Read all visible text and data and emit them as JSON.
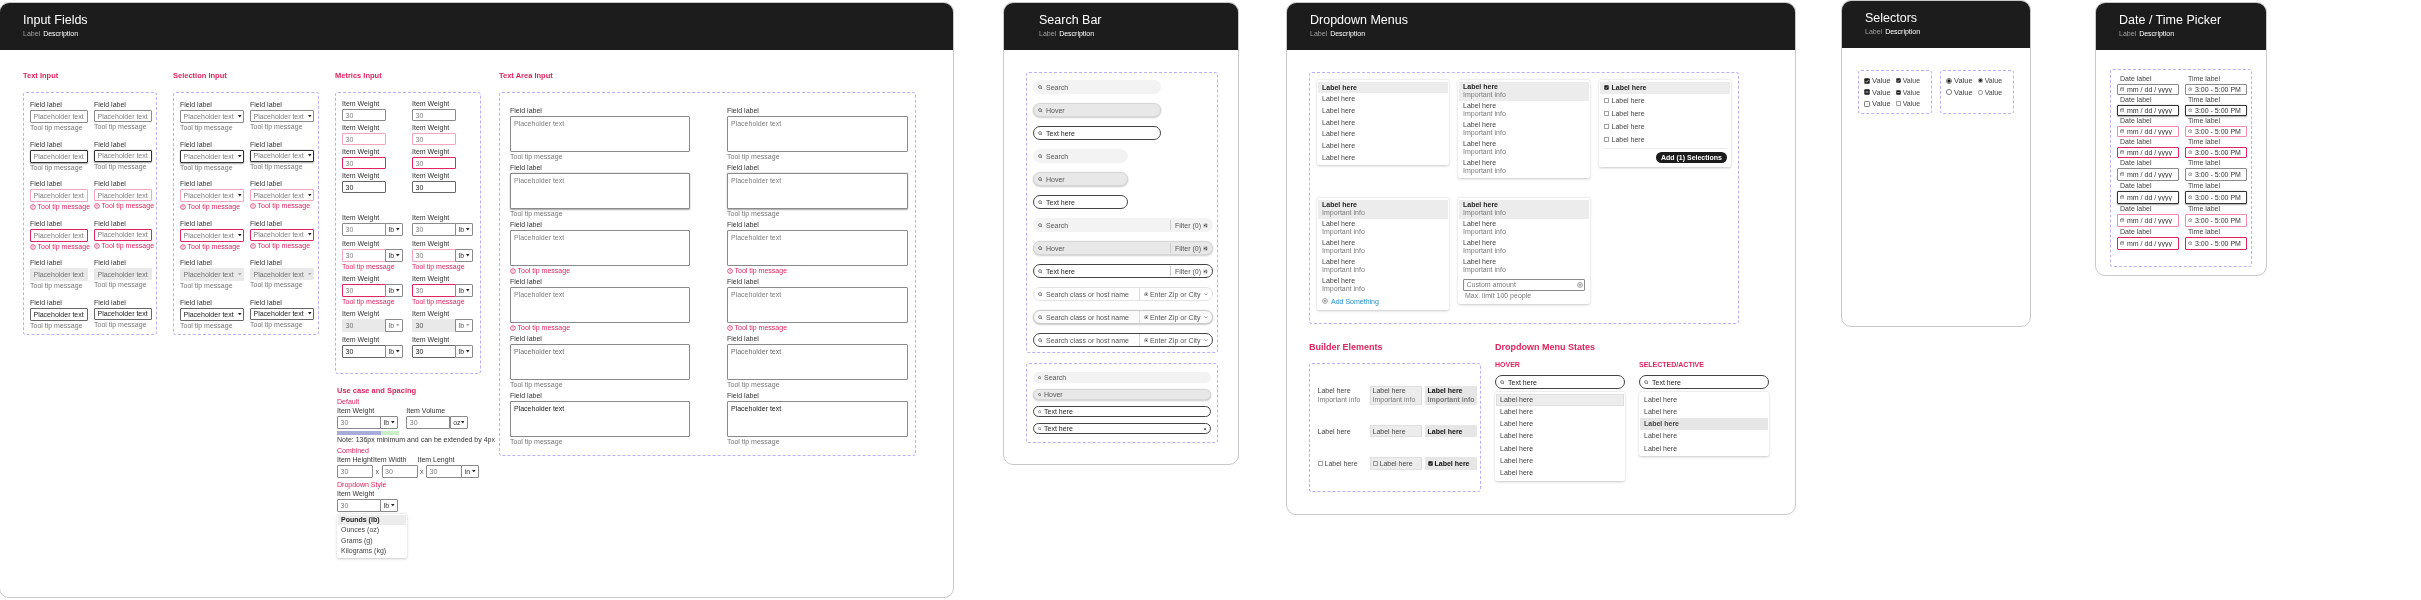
{
  "input_fields": {
    "title": "Input Fields",
    "label": "Label",
    "description": "Description",
    "text_input": {
      "title": "Text Input",
      "fields": [
        {
          "kind": "default",
          "label": "Field label",
          "placeholder": "Placeholder text",
          "message": "Tool tip message"
        },
        {
          "kind": "default",
          "label": "Field label",
          "placeholder": "Placeholder text",
          "message": "Tool tip message"
        },
        {
          "kind": "focus",
          "label": "Field label",
          "placeholder": "Placeholder text",
          "message": "Tool tip message"
        },
        {
          "kind": "focus",
          "label": "Field label",
          "placeholder": "Placeholder text",
          "message": "Tool tip message"
        },
        {
          "kind": "error",
          "label": "Field label",
          "placeholder": "Placeholder text",
          "message": "Tool tip message",
          "alert_icon": true
        },
        {
          "kind": "error",
          "label": "Field label",
          "placeholder": "Placeholder text",
          "message": "Tool tip message",
          "alert_icon": true
        },
        {
          "kind": "error_focus",
          "label": "Field label",
          "placeholder": "Placeholder text",
          "message": "Tool tip message",
          "alert_icon": true
        },
        {
          "kind": "error_focus",
          "label": "Field label",
          "placeholder": "Placeholder text",
          "message": "Tool tip message",
          "alert_icon": true
        },
        {
          "kind": "disabled",
          "label": "Field label",
          "placeholder": "Placeholder text",
          "message": "Tool tip message"
        },
        {
          "kind": "disabled",
          "label": "Field label",
          "placeholder": "Placeholder text",
          "message": "Tool tip message"
        },
        {
          "kind": "filled",
          "label": "Field label",
          "value": "Placeholder text",
          "message": "Tool tip message"
        },
        {
          "kind": "filled",
          "label": "Field label",
          "value": "Placeholder text",
          "message": "Tool tip message"
        }
      ]
    },
    "selection_input": {
      "title": "Selection Input",
      "fields": [
        {
          "kind": "default",
          "label": "Field label",
          "placeholder": "Placeholder text",
          "message": "Tool tip message"
        },
        {
          "kind": "default",
          "label": "Field label",
          "placeholder": "Placeholder text",
          "message": "Tool tip message"
        },
        {
          "kind": "focus",
          "label": "Field label",
          "placeholder": "Placeholder text",
          "message": "Tool tip message"
        },
        {
          "kind": "focus",
          "label": "Field label",
          "placeholder": "Placeholder text",
          "message": "Tool tip message"
        },
        {
          "kind": "error",
          "label": "Field label",
          "placeholder": "Placeholder text",
          "message": "Tool tip message",
          "alert_icon": true
        },
        {
          "kind": "error",
          "label": "Field label",
          "placeholder": "Placeholder text",
          "message": "Tool tip message",
          "alert_icon": true
        },
        {
          "kind": "error_focus",
          "label": "Field label",
          "placeholder": "Placeholder text",
          "message": "Tool tip message",
          "alert_icon": true
        },
        {
          "kind": "error_focus",
          "label": "Field label",
          "placeholder": "Placeholder text",
          "message": "Tool tip message",
          "alert_icon": true
        },
        {
          "kind": "disabled",
          "label": "Field label",
          "placeholder": "Placeholder text",
          "message": "Tool tip message"
        },
        {
          "kind": "disabled",
          "label": "Field label",
          "placeholder": "Placeholder text",
          "message": "Tool tip message"
        },
        {
          "kind": "filled",
          "label": "Field label",
          "value": "Placeholder text",
          "message": "Tool tip message"
        },
        {
          "kind": "filled",
          "label": "Field label",
          "value": "Placeholder text",
          "message": "Tool tip message"
        }
      ]
    },
    "metrics_input": {
      "title": "Metrics Input",
      "plain": [
        {
          "kind": "default",
          "label": "Item Weight",
          "placeholder": "30"
        },
        {
          "kind": "default",
          "label": "Item Weight",
          "placeholder": "30"
        },
        {
          "kind": "error",
          "label": "Item Weight",
          "placeholder": "30"
        },
        {
          "kind": "error",
          "label": "Item Weight",
          "placeholder": "30"
        },
        {
          "kind": "error_focus",
          "label": "Item Weight",
          "placeholder": "30"
        },
        {
          "kind": "error_focus",
          "label": "Item Weight",
          "placeholder": "30"
        },
        {
          "kind": "filled",
          "label": "Item Weight",
          "value": "30"
        },
        {
          "kind": "filled",
          "label": "Item Weight",
          "value": "30"
        }
      ],
      "with_unit": [
        {
          "kind": "default",
          "label": "Item Weight",
          "placeholder": "30",
          "unit": "lb"
        },
        {
          "kind": "default",
          "label": "Item Weight",
          "placeholder": "30",
          "unit": "lb"
        },
        {
          "kind": "error",
          "label": "Item Weight",
          "placeholder": "30",
          "unit": "lb",
          "message": "Tool tip message"
        },
        {
          "kind": "error",
          "label": "Item Weight",
          "placeholder": "30",
          "unit": "lb",
          "message": "Tool tip message"
        },
        {
          "kind": "error_focus",
          "label": "Item Weight",
          "placeholder": "30",
          "unit": "lb",
          "message": "Tool tip message"
        },
        {
          "kind": "error_focus",
          "label": "Item Weight",
          "placeholder": "30",
          "unit": "lb",
          "message": "Tool tip message"
        },
        {
          "kind": "disabled",
          "label": "Item Weight",
          "placeholder": "30",
          "unit": "lb"
        },
        {
          "kind": "disabled",
          "label": "Item Weight",
          "value": "30",
          "unit": "lb"
        },
        {
          "kind": "filled",
          "label": "Item Weight",
          "value": "30",
          "unit": "lb"
        },
        {
          "kind": "filled",
          "label": "Item Weight",
          "value": "30",
          "unit": "lb"
        }
      ]
    },
    "use_case": {
      "title": "Use case and Spacing",
      "default": {
        "title": "Default",
        "fields": [
          {
            "label": "Item Weight",
            "placeholder": "30",
            "unit": "lb"
          },
          {
            "label": "Item Volume",
            "placeholder": "30",
            "unit": "oz"
          }
        ],
        "note": "Note: 136px minimum and can be extended by 4px"
      },
      "combined": {
        "title": "Combined",
        "fields": [
          {
            "label": "Item Height",
            "placeholder": "30"
          },
          {
            "label": "Item Width",
            "placeholder": "30",
            "separator": "x"
          },
          {
            "label": "Item Lenght",
            "placeholder": "30",
            "unit": "in",
            "separator": "x"
          }
        ]
      },
      "dropdown_style": {
        "title": "Dropdown Style",
        "field": {
          "label": "Item Weight",
          "placeholder": "30",
          "unit": "lb"
        },
        "options": [
          {
            "label": "Pounds (lb)",
            "selected": true
          },
          {
            "label": "Ounces (oz)",
            "selected": false
          },
          {
            "label": "Grams (g)",
            "selected": false
          },
          {
            "label": "Kilograms (kg)",
            "selected": false
          }
        ]
      }
    },
    "text_area": {
      "title": "Text Area Input",
      "fields": [
        {
          "kind": "default",
          "label": "Field label",
          "placeholder": "Placeholder text",
          "message": "Tool tip message"
        },
        {
          "kind": "default",
          "label": "Field label",
          "placeholder": "Placeholder text",
          "message": "Tool tip message"
        },
        {
          "kind": "focus",
          "label": "Field label",
          "placeholder": "Placeholder text",
          "message": "Tool tip message"
        },
        {
          "kind": "focus",
          "label": "Field label",
          "placeholder": "Placeholder text",
          "message": "Tool tip message"
        },
        {
          "kind": "error",
          "label": "Field label",
          "placeholder": "Placeholder text",
          "message": "Tool tip message",
          "alert_icon": true
        },
        {
          "kind": "error",
          "label": "Field label",
          "placeholder": "Placeholder text",
          "message": "Tool tip message",
          "alert_icon": true
        },
        {
          "kind": "error_focus",
          "label": "Field label",
          "placeholder": "Placeholder text",
          "message": "Tool tip message",
          "alert_icon": true
        },
        {
          "kind": "error_focus",
          "label": "Field label",
          "placeholder": "Placeholder text",
          "message": "Tool tip message",
          "alert_icon": true
        },
        {
          "kind": "disabled",
          "label": "Field label",
          "placeholder": "Placeholder text",
          "message": "Tool tip message"
        },
        {
          "kind": "disabled",
          "label": "Field label",
          "placeholder": "Placeholder text",
          "message": "Tool tip message"
        },
        {
          "kind": "filled",
          "label": "Field label",
          "value": "Placeholder text",
          "message": "Tool tip message"
        },
        {
          "kind": "filled",
          "label": "Field label",
          "value": "Placeholder text",
          "message": "Tool tip message"
        }
      ]
    }
  },
  "search_bar": {
    "title": "Search Bar",
    "label": "Label",
    "description": "Description",
    "groups": [
      {
        "bars": [
          {
            "kind": "wide",
            "hover": false,
            "active": false,
            "placeholder": "Search"
          },
          {
            "kind": "wide",
            "hover": true,
            "active": false,
            "placeholder": "Hover"
          },
          {
            "kind": "wide",
            "hover": false,
            "active": true,
            "value": "Text here"
          },
          {
            "kind": "medium",
            "hover": false,
            "active": false,
            "placeholder": "Search"
          },
          {
            "kind": "medium",
            "hover": true,
            "active": false,
            "placeholder": "Hover"
          },
          {
            "kind": "medium",
            "hover": false,
            "active": true,
            "value": "Text here"
          },
          {
            "kind": "filter",
            "hover": false,
            "active": false,
            "placeholder": "Search",
            "filter": "Filter (0)"
          },
          {
            "kind": "filter",
            "hover": true,
            "active": false,
            "placeholder": "Hover",
            "filter": "Filter (0)"
          },
          {
            "kind": "filter",
            "hover": false,
            "active": true,
            "value": "Text here",
            "filter": "Filter (0)"
          },
          {
            "kind": "location",
            "hover": false,
            "active": false,
            "placeholder": "Search class or host name",
            "location": "Enter Zip or City"
          },
          {
            "kind": "location",
            "hover": true,
            "active": false,
            "placeholder": "Search class or host name",
            "location": "Enter Zip or City"
          },
          {
            "kind": "location",
            "hover": false,
            "active": true,
            "placeholder": "Search class or host name",
            "location": "Enter Zip or City"
          }
        ]
      },
      {
        "bars": [
          {
            "kind": "small",
            "hover": false,
            "active": false,
            "placeholder": "Search"
          },
          {
            "kind": "small",
            "hover": true,
            "active": false,
            "placeholder": "Hover"
          },
          {
            "kind": "small",
            "hover": false,
            "active": true,
            "value": "Text here"
          },
          {
            "kind": "small",
            "hover": false,
            "active": true,
            "value": "Text here",
            "clear": true
          }
        ]
      }
    ]
  },
  "dropdown_menus": {
    "title": "Dropdown Menus",
    "label": "Label",
    "description": "Description",
    "menus": [
      {
        "kind": "simple",
        "items": [
          {
            "label": "Label here",
            "highlighted": true
          },
          {
            "label": "Label here",
            "highlighted": false
          },
          {
            "label": "Label here",
            "highlighted": false
          },
          {
            "label": "Label here",
            "highlighted": false
          },
          {
            "label": "Label here",
            "highlighted": false
          },
          {
            "label": "Label here",
            "highlighted": false
          },
          {
            "label": "Label here",
            "highlighted": false
          }
        ]
      },
      {
        "kind": "two_line",
        "items": [
          {
            "label": "Label here",
            "info": "Important info",
            "highlighted": true
          },
          {
            "label": "Label here",
            "info": "Important info",
            "highlighted": false
          },
          {
            "label": "Label here",
            "info": "Important info",
            "highlighted": false
          },
          {
            "label": "Label here",
            "info": "Important info",
            "highlighted": false
          },
          {
            "label": "Label here",
            "info": "Important info",
            "highlighted": false
          }
        ]
      },
      {
        "kind": "checkbox",
        "items": [
          {
            "label": "Label here",
            "highlighted": true,
            "checked": true
          },
          {
            "label": "Label here",
            "highlighted": false,
            "checked": false
          },
          {
            "label": "Label here",
            "highlighted": false,
            "checked": false
          },
          {
            "label": "Label here",
            "highlighted": false,
            "checked": false
          },
          {
            "label": "Label here",
            "highlighted": false,
            "checked": false
          }
        ],
        "button": "Add (1) Selections"
      },
      {
        "kind": "two_line",
        "items": [
          {
            "label": "Label here",
            "info": "Important info",
            "highlighted": true
          },
          {
            "label": "Label here",
            "info": "Important info",
            "highlighted": false
          },
          {
            "label": "Label here",
            "info": "Important info",
            "highlighted": false
          },
          {
            "label": "Label here",
            "info": "Important info",
            "highlighted": false
          },
          {
            "label": "Label here",
            "info": "Important info",
            "highlighted": false
          }
        ],
        "add_link": "Add Something"
      },
      {
        "kind": "two_line",
        "items": [
          {
            "label": "Label here",
            "info": "Important info",
            "highlighted": true
          },
          {
            "label": "Label here",
            "info": "Important info",
            "highlighted": false
          },
          {
            "label": "Label here",
            "info": "Important info",
            "highlighted": false
          },
          {
            "label": "Label here",
            "info": "Important info",
            "highlighted": false
          }
        ],
        "input": {
          "placeholder": "Custom amount",
          "hint": "Max. limit 100 people"
        }
      }
    ],
    "builder": {
      "title": "Builder Elements",
      "rows": [
        {
          "kind": "two_line",
          "cells": [
            {
              "label": "Label here",
              "info": "Important info",
              "hover": false,
              "selected": false
            },
            {
              "label": "Label here",
              "info": "Important info",
              "hover": true,
              "selected": false
            },
            {
              "label": "Label here",
              "info": "Important info",
              "hover": false,
              "selected": true
            }
          ]
        },
        {
          "kind": "single",
          "cells": [
            {
              "label": "Label here",
              "hover": false,
              "selected": false
            },
            {
              "label": "Label here",
              "hover": true,
              "selected": false
            },
            {
              "label": "Label here",
              "hover": false,
              "selected": true
            }
          ]
        },
        {
          "kind": "checkbox",
          "cells": [
            {
              "label": "Label here",
              "hover": false,
              "selected": false
            },
            {
              "label": "Label here",
              "hover": true,
              "selected": false
            },
            {
              "label": "Label here",
              "hover": false,
              "selected": true
            }
          ]
        }
      ]
    },
    "states": {
      "title": "Dropdown Menu States",
      "panels": [
        {
          "title": "HOVER",
          "search": "Text here",
          "items": [
            {
              "label": "Label here",
              "hover": true,
              "selected": false
            },
            {
              "label": "Label here",
              "hover": false,
              "selected": false
            },
            {
              "label": "Label here",
              "hover": false,
              "selected": false
            },
            {
              "label": "Label here",
              "hover": false,
              "selected": false
            },
            {
              "label": "Label here",
              "hover": false,
              "selected": false
            },
            {
              "label": "Label here",
              "hover": false,
              "selected": false
            },
            {
              "label": "Label here",
              "hover": false,
              "selected": false
            }
          ]
        },
        {
          "title": "SELECTED/ACTIVE",
          "search": "Text here",
          "items": [
            {
              "label": "Label here",
              "hover": false,
              "selected": false
            },
            {
              "label": "Label here",
              "hover": false,
              "selected": false
            },
            {
              "label": "Label here",
              "hover": false,
              "selected": true
            },
            {
              "label": "Label here",
              "hover": false,
              "selected": false
            },
            {
              "label": "Label here",
              "hover": false,
              "selected": false
            }
          ]
        }
      ]
    }
  },
  "selectors": {
    "title": "Selectors",
    "label": "Label",
    "description": "Description",
    "checkboxes": [
      {
        "kind": "large",
        "label": "Value",
        "checked": true,
        "indeterminate": false
      },
      {
        "kind": "small",
        "label": "Value",
        "checked": true,
        "indeterminate": false
      },
      {
        "kind": "large",
        "label": "Value",
        "checked": false,
        "indeterminate": true
      },
      {
        "kind": "small",
        "label": "Value",
        "checked": false,
        "indeterminate": true
      },
      {
        "kind": "large",
        "label": "Value",
        "checked": false,
        "indeterminate": false
      },
      {
        "kind": "small",
        "label": "Value",
        "checked": false,
        "indeterminate": false
      }
    ],
    "radios": [
      {
        "kind": "large",
        "label": "Value",
        "selected": true
      },
      {
        "kind": "small",
        "label": "Value",
        "selected": true
      },
      {
        "kind": "large",
        "label": "Value",
        "selected": false
      },
      {
        "kind": "small",
        "label": "Value",
        "selected": false
      }
    ]
  },
  "date_time_picker": {
    "title": "Date / Time Picker",
    "label": "Label",
    "description": "Description",
    "rows": [
      {
        "kind": "small",
        "focused": false,
        "error": false,
        "date": {
          "label": "Date label",
          "placeholder": "mm / dd / yyyy"
        },
        "time": {
          "label": "Time label",
          "placeholder": "3:00 - 5:00 PM"
        }
      },
      {
        "kind": "small",
        "focused": true,
        "error": false,
        "date": {
          "label": "Date label",
          "placeholder": "mm / dd / yyyy"
        },
        "time": {
          "label": "Time label",
          "placeholder": "3:00 - 5:00 PM"
        }
      },
      {
        "kind": "small",
        "focused": false,
        "error": true,
        "date": {
          "label": "Date label",
          "placeholder": "mm / dd / yyyy"
        },
        "time": {
          "label": "Time label",
          "placeholder": "3:00 - 5:00 PM"
        }
      },
      {
        "kind": "small",
        "focused": true,
        "error": true,
        "date": {
          "label": "Date label",
          "placeholder": "mm / dd / yyyy"
        },
        "time": {
          "label": "Time label",
          "placeholder": "3:00 - 5:00 PM"
        }
      },
      {
        "kind": "large",
        "focused": false,
        "error": false,
        "date": {
          "label": "Date label",
          "placeholder": "mm / dd / yyyy"
        },
        "time": {
          "label": "Time label",
          "placeholder": "3:00 - 5:00 PM"
        }
      },
      {
        "kind": "large",
        "focused": true,
        "error": false,
        "date": {
          "label": "Date label",
          "placeholder": "mm / dd / yyyy"
        },
        "time": {
          "label": "Time label",
          "placeholder": "3:00 - 5:00 PM"
        }
      },
      {
        "kind": "large",
        "focused": false,
        "error": true,
        "date": {
          "label": "Date label",
          "placeholder": "mm / dd / yyyy"
        },
        "time": {
          "label": "Time label",
          "placeholder": "3:00 - 5:00 PM"
        }
      },
      {
        "kind": "large",
        "focused": true,
        "error": true,
        "date": {
          "label": "Date label",
          "placeholder": "mm / dd / yyyy"
        },
        "time": {
          "label": "Time label",
          "placeholder": "3:00 - 5:00 PM"
        }
      }
    ]
  }
}
